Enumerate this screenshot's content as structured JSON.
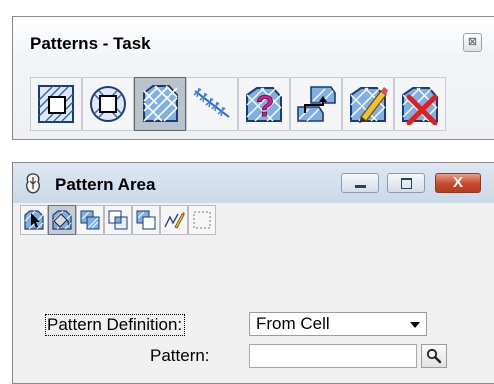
{
  "task_panel": {
    "title": "Patterns - Task",
    "close_glyph": "⊠",
    "tools": [
      {
        "icon": "hatch-area-icon"
      },
      {
        "icon": "crosshatch-area-icon"
      },
      {
        "icon": "pattern-area-icon",
        "active": true
      },
      {
        "icon": "linear-pattern-icon"
      },
      {
        "icon": "show-pattern-attributes-icon"
      },
      {
        "icon": "match-pattern-attributes-icon"
      },
      {
        "icon": "change-pattern-icon"
      },
      {
        "icon": "delete-pattern-icon"
      }
    ]
  },
  "pattern_area": {
    "title": "Pattern Area",
    "window_buttons": {
      "close_glyph": "X"
    },
    "methods": [
      {
        "icon": "element-method-icon"
      },
      {
        "icon": "flood-method-icon",
        "active": true
      },
      {
        "icon": "union-method-icon"
      },
      {
        "icon": "intersection-method-icon"
      },
      {
        "icon": "difference-method-icon"
      },
      {
        "icon": "points-method-icon"
      },
      {
        "icon": "fence-method-icon"
      }
    ],
    "pattern_definition_label": "Pattern Definition:",
    "pattern_definition_value": "From Cell",
    "pattern_label": "Pattern:",
    "pattern_value": ""
  }
}
